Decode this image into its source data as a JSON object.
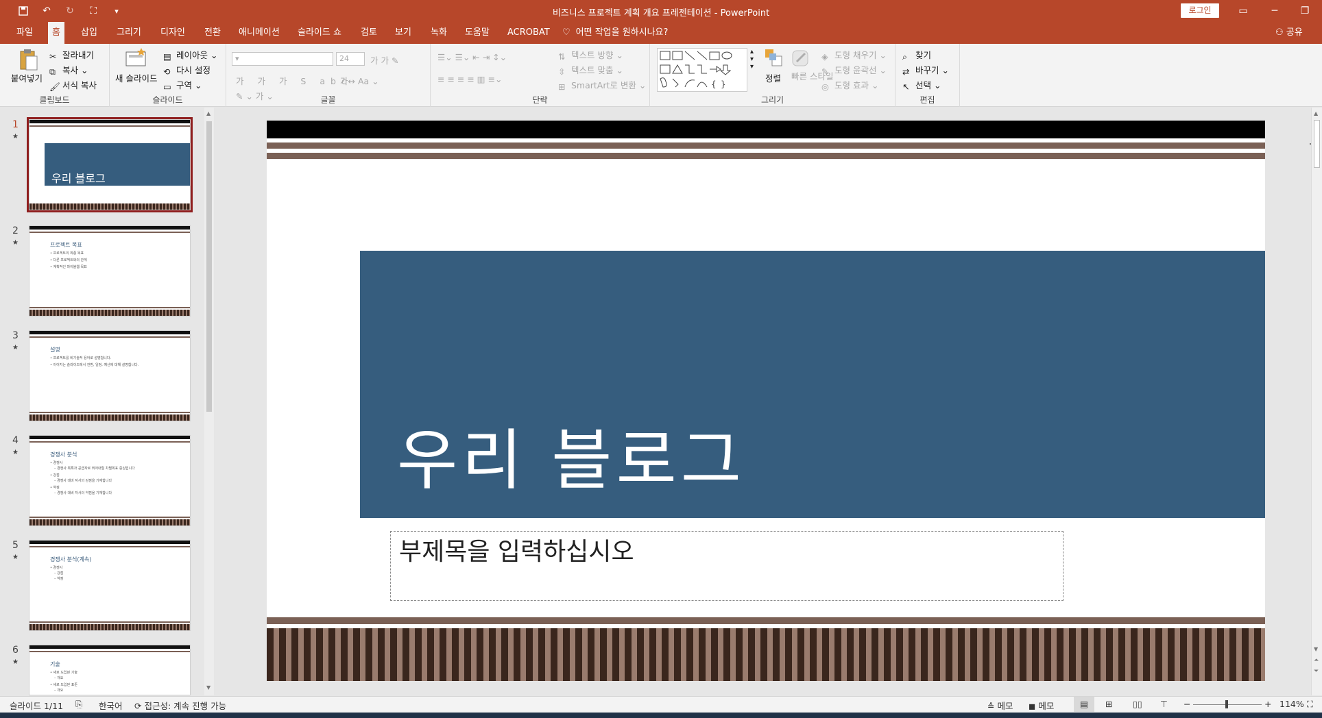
{
  "app": {
    "document_title": "비즈니스 프로젝트 계획 개요 프레젠테이션",
    "separator": " - ",
    "app_name": "PowerPoint",
    "login": "로그인",
    "share": "공유"
  },
  "tabs": [
    "파일",
    "홈",
    "삽입",
    "그리기",
    "디자인",
    "전환",
    "애니메이션",
    "슬라이드 쇼",
    "검토",
    "보기",
    "녹화",
    "도움말",
    "ACROBAT"
  ],
  "active_tab": "홈",
  "tell_me": "어떤 작업을 원하시나요?",
  "ribbon": {
    "clipboard": {
      "paste": "붙여넣기",
      "cut": "잘라내기",
      "copy": "복사",
      "format_painter": "서식 복사",
      "label": "클립보드"
    },
    "slides": {
      "new_slide": "새 슬라이드",
      "layout": "레이아웃",
      "reset": "다시 설정",
      "section": "구역",
      "label": "슬라이드"
    },
    "font": {
      "font_size": "24",
      "label": "글꼴"
    },
    "paragraph": {
      "text_direction": "텍스트 방향",
      "align_text": "텍스트 맞춤",
      "smartart": "SmartArt로 변환",
      "label": "단락"
    },
    "drawing": {
      "arrange": "정렬",
      "quick_styles": "빠른 스타일",
      "fill": "도형 채우기",
      "outline": "도형 윤곽선",
      "effects": "도형 효과",
      "label": "그리기"
    },
    "editing": {
      "find": "찾기",
      "replace": "바꾸기",
      "select": "선택",
      "label": "편집"
    }
  },
  "thumbnails": [
    {
      "num": "1",
      "title": "우리 블로그",
      "lines": []
    },
    {
      "num": "2",
      "title": "프로젝트 목표",
      "lines": [
        "• 프로젝트의 최종 목표",
        "• 다른 프로젝트와의 관계",
        "• 계획적인 마이블웹 목표"
      ]
    },
    {
      "num": "3",
      "title": "설명",
      "lines": [
        "• 프로젝트를 비기술적 용어로 설명합니다.",
        "• 이어지는 슬라이드에서 전환, 일정, 예산에 대해 설명합니다."
      ]
    },
    {
      "num": "4",
      "title": "경쟁사 분석",
      "lines": [
        "• 경쟁사",
        "– 경쟁사 목록과 공급자로 뛰어내릴 차별목표 중심입니다",
        "• 강점",
        "– 경쟁사 대비 자사의 강점을 기재합니다",
        "• 약점",
        "– 경쟁사 대비 자사의 약점을 기재합니다"
      ]
    },
    {
      "num": "5",
      "title": "경쟁사 분석(계속)",
      "lines": [
        "• 경쟁사",
        "– 강점",
        "– 약점"
      ]
    },
    {
      "num": "6",
      "title": "기술",
      "lines": [
        "• 새로 도입된 기술",
        "– 개요",
        "• 새로 도입된 표준",
        "– 개요"
      ]
    }
  ],
  "slide": {
    "title": "우리 블로그",
    "subtitle_placeholder": "부제목을 입력하십시오"
  },
  "status": {
    "slide_info": "슬라이드 1/11",
    "language": "한국어",
    "accessibility": "접근성: 계속 진행 가능",
    "notes": "메모",
    "comments": "메모",
    "zoom": "114%"
  },
  "colors": {
    "accent": "#b7472a",
    "slide_title_fill": "#365d7e",
    "stripe_dark": "#3a261d",
    "stripe_light": "#9a7c6e"
  }
}
